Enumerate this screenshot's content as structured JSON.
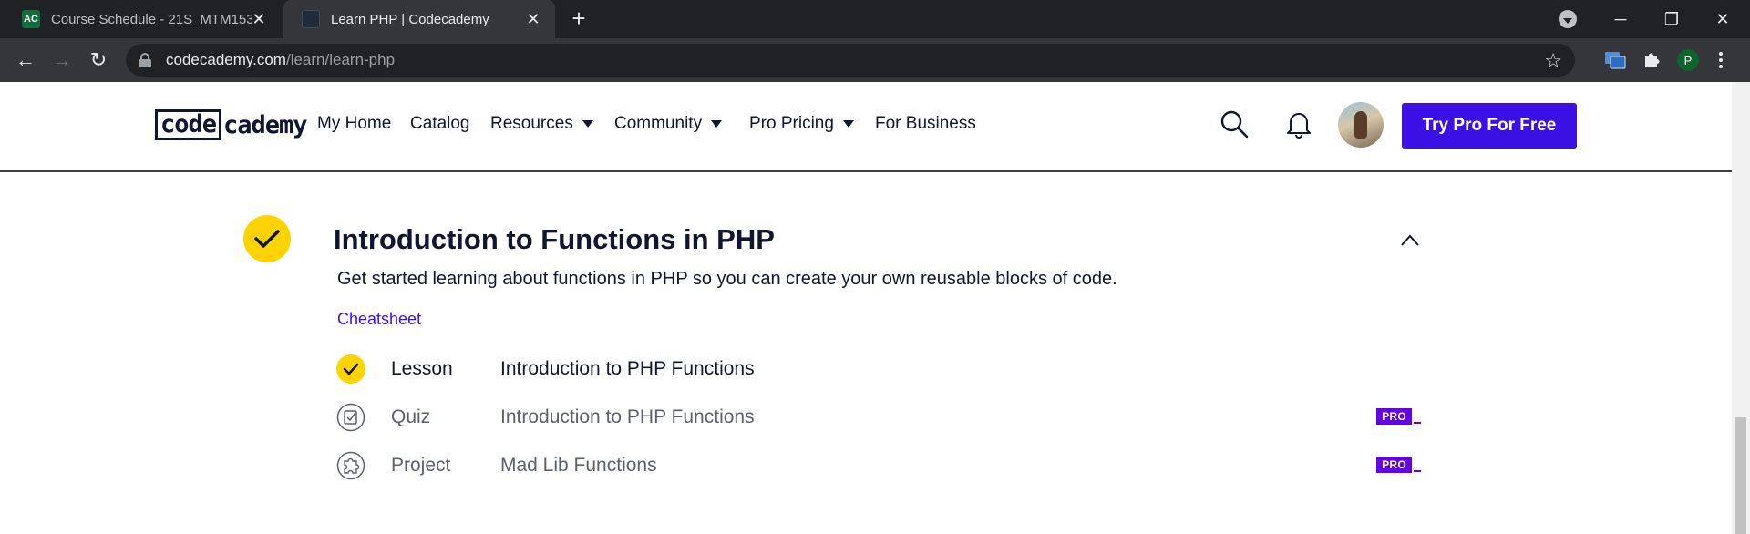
{
  "browser": {
    "tabs": [
      {
        "title": "Course Schedule - 21S_MTM153",
        "favicon": "AC",
        "active": false
      },
      {
        "title": "Learn PHP | Codecademy",
        "favicon": "codecademy-favicon",
        "active": true
      }
    ],
    "url_host": "codecademy.com",
    "url_path": "/learn/learn-php",
    "profile_initial": "P"
  },
  "site_nav": {
    "logo_boxed": "code",
    "logo_rest": "cademy",
    "links": [
      {
        "label": "My Home",
        "dropdown": false
      },
      {
        "label": "Catalog",
        "dropdown": false
      },
      {
        "label": "Resources",
        "dropdown": true
      },
      {
        "label": "Community",
        "dropdown": true
      },
      {
        "label": "Pro Pricing",
        "dropdown": true
      },
      {
        "label": "For Business",
        "dropdown": false
      }
    ],
    "cta_label": "Try Pro For Free"
  },
  "module": {
    "title": "Introduction to Functions in PHP",
    "description": "Get started learning about functions in PHP so you can create your own reusable blocks of code.",
    "cheatsheet_label": "Cheatsheet",
    "status": "completed",
    "items": [
      {
        "type": "Lesson",
        "name": "Introduction to PHP Functions",
        "icon": "check-icon",
        "completed": true,
        "pro": false
      },
      {
        "type": "Quiz",
        "name": "Introduction to PHP Functions",
        "icon": "quiz-icon",
        "completed": false,
        "pro": true
      },
      {
        "type": "Project",
        "name": "Mad Lib Functions",
        "icon": "project-puzzle-icon",
        "completed": false,
        "pro": true
      }
    ],
    "pro_badge_label": "PRO"
  },
  "colors": {
    "brand_blue": "#3a10e5",
    "done_yellow": "#ffd300",
    "pro_purple": "#6400e4",
    "navy_text": "#10162f"
  }
}
